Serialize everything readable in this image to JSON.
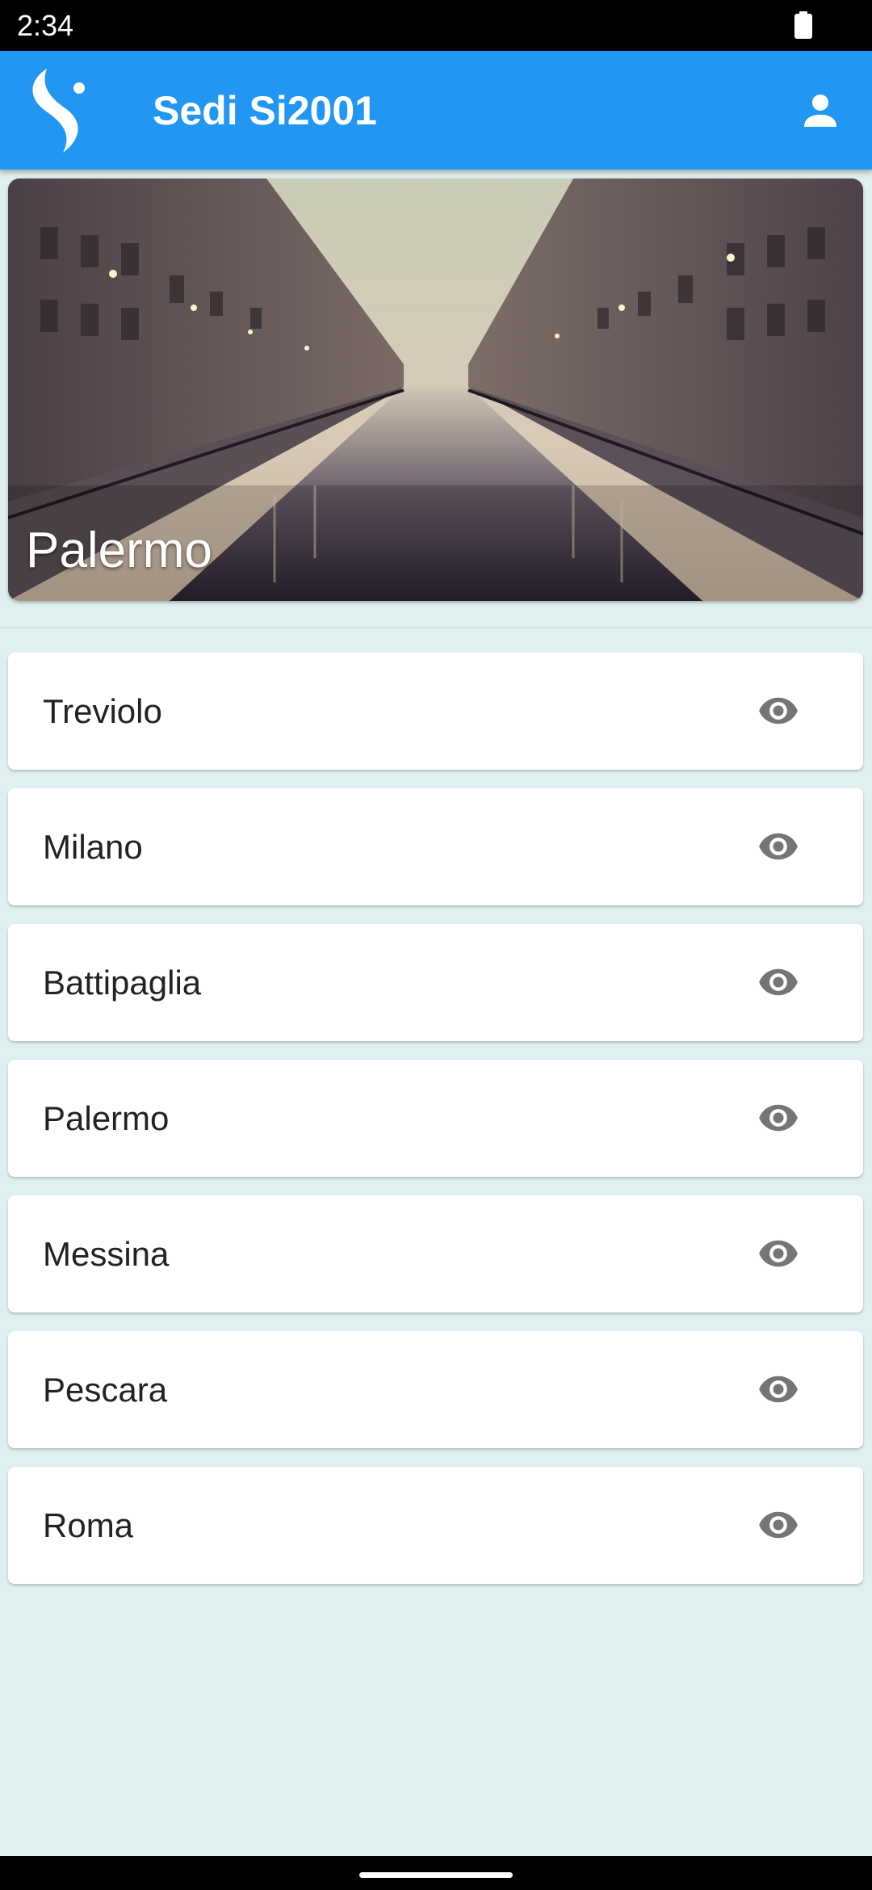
{
  "status_bar": {
    "time": "2:34",
    "battery_icon": "battery-full-icon"
  },
  "app_bar": {
    "logo_icon": "si2001-logo-icon",
    "title": "Sedi Si2001",
    "account_icon": "person-icon",
    "color": "#2196f3"
  },
  "hero": {
    "title": "Palermo",
    "image": "canal-city-photo"
  },
  "cities": [
    {
      "name": "Treviolo",
      "action_icon": "eye-icon"
    },
    {
      "name": "Milano",
      "action_icon": "eye-icon"
    },
    {
      "name": "Battipaglia",
      "action_icon": "eye-icon"
    },
    {
      "name": "Palermo",
      "action_icon": "eye-icon"
    },
    {
      "name": "Messina",
      "action_icon": "eye-icon"
    },
    {
      "name": "Pescara",
      "action_icon": "eye-icon"
    },
    {
      "name": "Roma",
      "action_icon": "eye-icon"
    }
  ],
  "colors": {
    "background": "#e0f0f0",
    "card": "#ffffff",
    "icon": "#757575"
  }
}
